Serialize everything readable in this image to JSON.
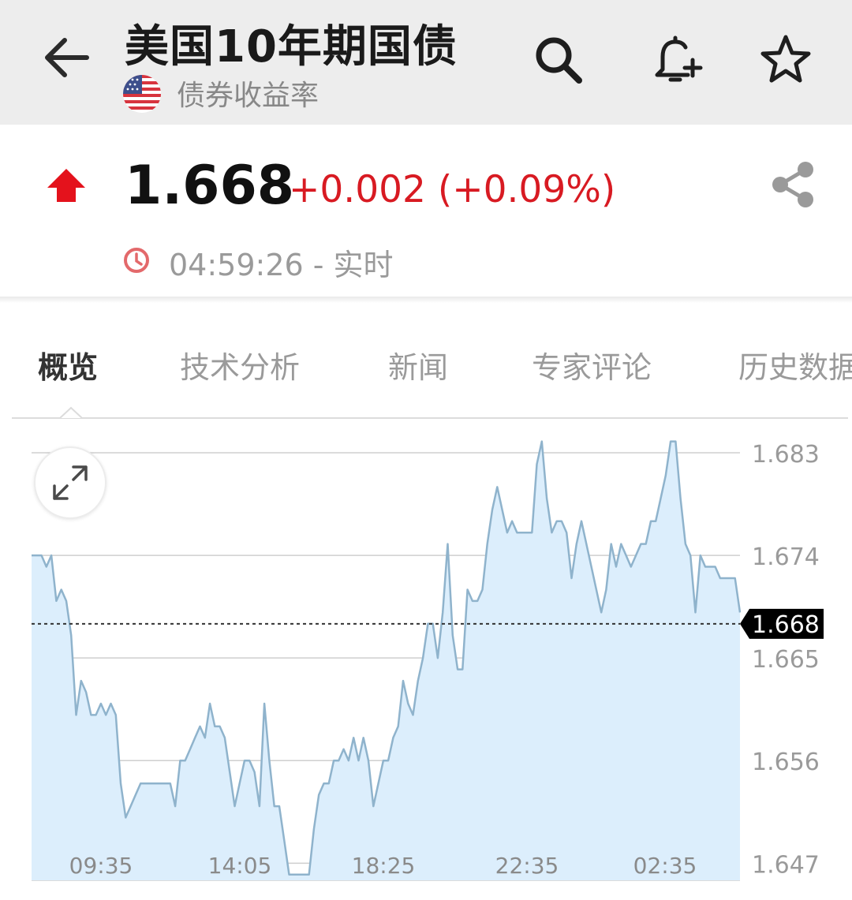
{
  "header": {
    "title": "美国10年期国债",
    "subtitle": "债券收益率",
    "icons": [
      "back-arrow-icon",
      "search-icon",
      "add-alert-bell-icon",
      "star-icon",
      "us-flag-icon"
    ]
  },
  "quote": {
    "price": "1.668",
    "change": "+0.002 (+0.09%)",
    "time": "04:59:26 - 实时",
    "direction": "up",
    "up_color": "#d81a22"
  },
  "tabs": [
    "概览",
    "技术分析",
    "新闻",
    "专家评论",
    "历史数据"
  ],
  "active_tab": "概览",
  "chart_data": {
    "type": "area",
    "x_tick_labels": [
      "09:35",
      "14:05",
      "18:25",
      "22:35",
      "02:35"
    ],
    "y_tick_labels": [
      "1.683",
      "1.674",
      "1.665",
      "1.656",
      "1.647"
    ],
    "ylim": [
      1.6455,
      1.6857
    ],
    "current_value_label": "1.668",
    "line_color": "#8fb3cc",
    "fill_color": "#dceefc",
    "grid": true,
    "values": [
      1.674,
      1.674,
      1.674,
      1.673,
      1.674,
      1.67,
      1.671,
      1.67,
      1.667,
      1.66,
      1.663,
      1.662,
      1.66,
      1.66,
      1.661,
      1.66,
      1.661,
      1.66,
      1.654,
      1.651,
      1.652,
      1.653,
      1.654,
      1.654,
      1.654,
      1.654,
      1.654,
      1.654,
      1.654,
      1.652,
      1.656,
      1.656,
      1.657,
      1.658,
      1.659,
      1.658,
      1.661,
      1.659,
      1.659,
      1.658,
      1.655,
      1.652,
      1.654,
      1.656,
      1.656,
      1.655,
      1.652,
      1.661,
      1.656,
      1.652,
      1.652,
      1.649,
      1.646,
      1.646,
      1.646,
      1.646,
      1.646,
      1.65,
      1.653,
      1.654,
      1.654,
      1.656,
      1.656,
      1.657,
      1.656,
      1.658,
      1.656,
      1.658,
      1.656,
      1.652,
      1.654,
      1.656,
      1.656,
      1.658,
      1.659,
      1.663,
      1.661,
      1.66,
      1.663,
      1.665,
      1.668,
      1.668,
      1.665,
      1.669,
      1.675,
      1.667,
      1.664,
      1.664,
      1.671,
      1.67,
      1.67,
      1.671,
      1.675,
      1.678,
      1.68,
      1.678,
      1.676,
      1.677,
      1.676,
      1.676,
      1.676,
      1.676,
      1.682,
      1.684,
      1.679,
      1.676,
      1.677,
      1.677,
      1.676,
      1.672,
      1.675,
      1.677,
      1.675,
      1.673,
      1.671,
      1.669,
      1.671,
      1.675,
      1.673,
      1.675,
      1.674,
      1.673,
      1.674,
      1.675,
      1.675,
      1.677,
      1.677,
      1.679,
      1.681,
      1.684,
      1.684,
      1.679,
      1.675,
      1.674,
      1.669,
      1.674,
      1.673,
      1.673,
      1.673,
      1.672,
      1.672,
      1.672,
      1.672,
      1.669
    ]
  }
}
